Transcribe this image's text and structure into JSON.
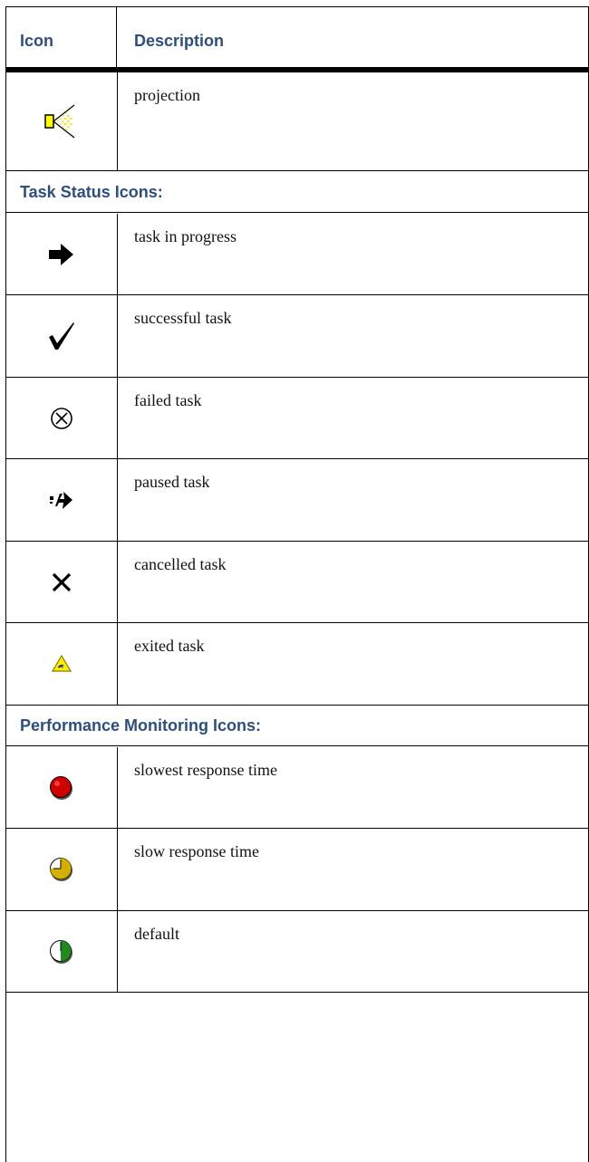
{
  "header": {
    "icon": "Icon",
    "description": "Description"
  },
  "rows": [
    {
      "icon": "projection-icon",
      "text": "projection"
    }
  ],
  "sections": [
    {
      "title": "Task Status Icons:",
      "rows": [
        {
          "icon": "task-in-progress-icon",
          "text": "task in progress"
        },
        {
          "icon": "successful-task-icon",
          "text": "successful task"
        },
        {
          "icon": "failed-task-icon",
          "text": "failed task"
        },
        {
          "icon": "paused-task-icon",
          "text": "paused task"
        },
        {
          "icon": "cancelled-task-icon",
          "text": "cancelled task"
        },
        {
          "icon": "exited-task-icon",
          "text": "exited task"
        }
      ]
    },
    {
      "title": "Performance Monitoring Icons:",
      "rows": [
        {
          "icon": "slowest-response-time-icon",
          "text": "slowest response time"
        },
        {
          "icon": "slow-response-time-icon",
          "text": "slow response time"
        },
        {
          "icon": "default-response-icon",
          "text": "default"
        }
      ]
    }
  ],
  "colors": {
    "heading": "#2e4f7c",
    "projector_yellow": "#ffff00",
    "slowest_red": "#d10000",
    "slow_yellow": "#d4b000",
    "default_green": "#1f8a1f"
  }
}
